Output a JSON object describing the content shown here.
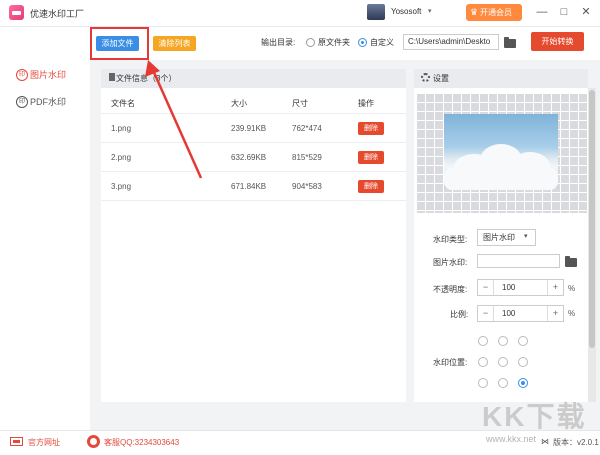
{
  "window": {
    "title": "优速水印工厂",
    "username": "Yososoft",
    "vip_label": "开通会员",
    "min_glyph": "—",
    "max_glyph": "□",
    "close_glyph": "✕",
    "caret_glyph": "▾"
  },
  "sidebar": {
    "items": [
      {
        "label": "图片水印",
        "icon": "image-watermark-icon",
        "active": true,
        "icon_glyph": "印"
      },
      {
        "label": "PDF水印",
        "icon": "pdf-watermark-icon",
        "active": false,
        "icon_glyph": "印"
      }
    ]
  },
  "toolbar": {
    "add_label": "添加文件",
    "clear_label": "清除列表",
    "output_label": "输出目录:",
    "option_original": "原文件夹",
    "option_custom": "自定义",
    "selected_option": "自定义",
    "path_value": "C:\\Users\\admin\\Deskto",
    "start_label": "开始转换"
  },
  "file_list": {
    "header_label": "文件信息（3个）",
    "columns": [
      "文件名",
      "大小",
      "尺寸",
      "操作"
    ],
    "rows": [
      {
        "name": "1.png",
        "size": "239.91KB",
        "dims": "762*474",
        "action": "删除"
      },
      {
        "name": "2.png",
        "size": "632.69KB",
        "dims": "815*529",
        "action": "删除"
      },
      {
        "name": "3.png",
        "size": "671.84KB",
        "dims": "904*583",
        "action": "删除"
      }
    ]
  },
  "settings": {
    "title": "设置",
    "watermark_type_label": "水印类型:",
    "watermark_type_value": "图片水印",
    "image_watermark_label": "图片水印:",
    "image_watermark_value": "",
    "opacity_label": "不透明度:",
    "opacity_value": "100",
    "scale_label": "比例:",
    "scale_value": "100",
    "percent": "%",
    "minus": "−",
    "plus": "+",
    "position_label": "水印位置:",
    "position_selected": "bottom-right"
  },
  "footer": {
    "website_label": "官方网址",
    "support_label": "客服QQ:3234303643",
    "version_label": "版本：v2.0.1"
  },
  "watermark_overlay": {
    "text": "KK下载",
    "url": "www.kkx.net"
  },
  "colors": {
    "accent_blue": "#3a8ee6",
    "accent_orange": "#f5a623",
    "danger_red": "#e64a2e",
    "vip_orange": "#ff8a3d",
    "annotation_red": "#e53935"
  }
}
